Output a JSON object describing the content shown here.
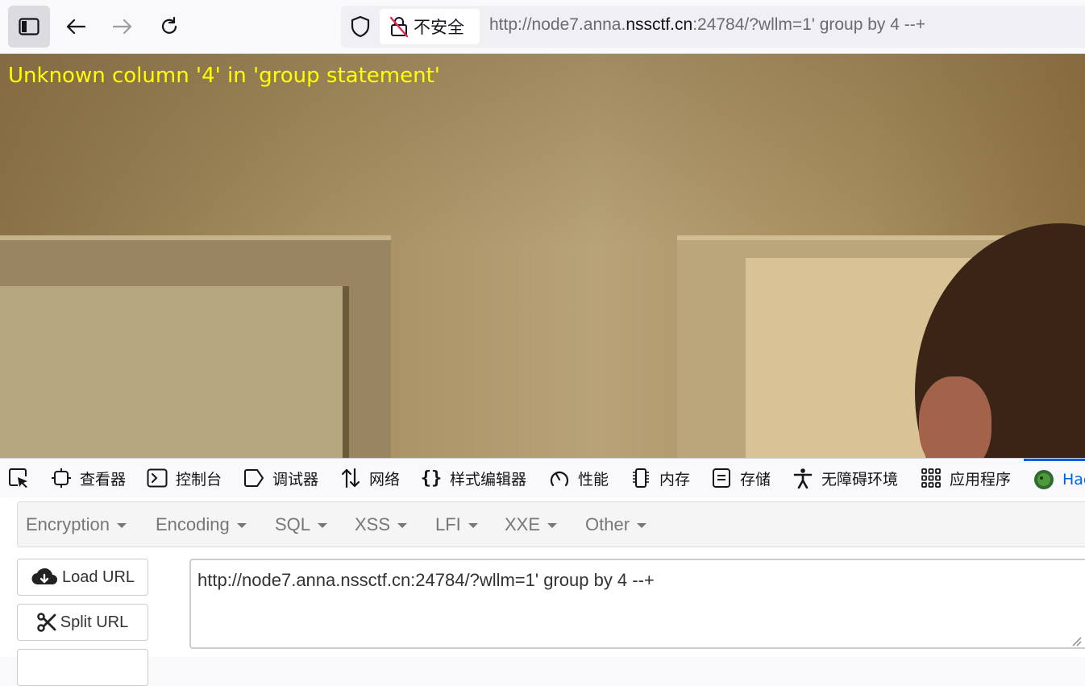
{
  "browser": {
    "security_label": "不安全",
    "url_prefix": "http://node7.anna.",
    "url_host": "nssctf.cn",
    "url_suffix": ":24784/?wllm=1' group by 4 --+"
  },
  "page": {
    "error_message": "Unknown column '4' in 'group statement'"
  },
  "devtools": {
    "tabs": [
      {
        "label": "查看器",
        "icon": "inspector-icon"
      },
      {
        "label": "控制台",
        "icon": "console-icon"
      },
      {
        "label": "调试器",
        "icon": "debugger-icon"
      },
      {
        "label": "网络",
        "icon": "network-icon"
      },
      {
        "label": "样式编辑器",
        "icon": "style-editor-icon"
      },
      {
        "label": "性能",
        "icon": "performance-icon"
      },
      {
        "label": "内存",
        "icon": "memory-icon"
      },
      {
        "label": "存储",
        "icon": "storage-icon"
      },
      {
        "label": "无障碍环境",
        "icon": "accessibility-icon"
      },
      {
        "label": "应用程序",
        "icon": "application-icon"
      },
      {
        "label": "Hac",
        "icon": "hackbar-icon"
      }
    ],
    "accent_color": "#0061e0"
  },
  "hackbar": {
    "menu": [
      "Encryption",
      "Encoding",
      "SQL",
      "XSS",
      "LFI",
      "XXE",
      "Other"
    ],
    "load_url": "Load URL",
    "split_url": "Split URL",
    "url_value": "http://node7.anna.nssctf.cn:24784/?wllm=1' group by 4 --+"
  },
  "colors": {
    "error_text": "#ffff00"
  }
}
